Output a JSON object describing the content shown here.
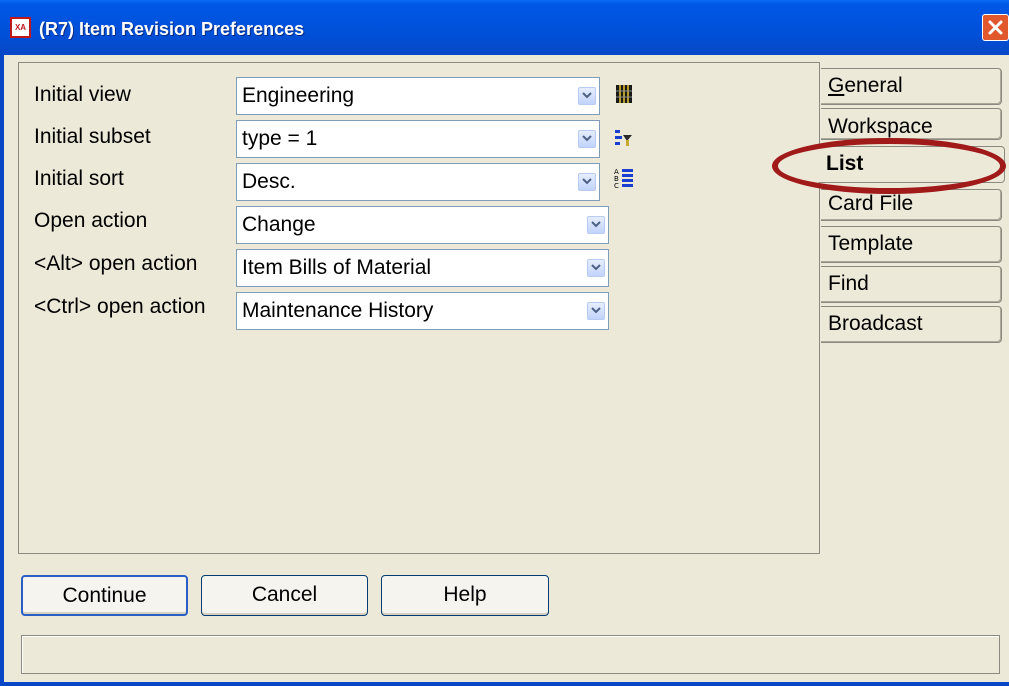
{
  "window": {
    "icon_text": "XA",
    "title": "(R7) Item Revision Preferences"
  },
  "fields": [
    {
      "label": "Initial view",
      "value": "Engineering",
      "icon": "view-icon"
    },
    {
      "label": "Initial subset",
      "value": "type = 1",
      "icon": "subset-icon"
    },
    {
      "label": "Initial sort",
      "value": "Desc.",
      "icon": "sort-icon"
    },
    {
      "label": "Open action",
      "value": "Change"
    },
    {
      "label": "<Alt> open action",
      "value": "Item Bills of Material"
    },
    {
      "label": "<Ctrl> open action",
      "value": "Maintenance History"
    }
  ],
  "tabs": [
    {
      "label": "General",
      "active": false
    },
    {
      "label": "Workspace",
      "active": false
    },
    {
      "label": "List",
      "active": true
    },
    {
      "label": "Card File",
      "active": false
    },
    {
      "label": "Template",
      "active": false
    },
    {
      "label": "Find",
      "active": false
    },
    {
      "label": "Broadcast",
      "active": false
    }
  ],
  "buttons": {
    "continue": "Continue",
    "cancel": "Cancel",
    "help": "Help"
  },
  "status_text": "",
  "colors": {
    "title_bar": "#0050d8",
    "window_bg": "#ece9d8",
    "annotation_circle": "#a11a1a"
  }
}
